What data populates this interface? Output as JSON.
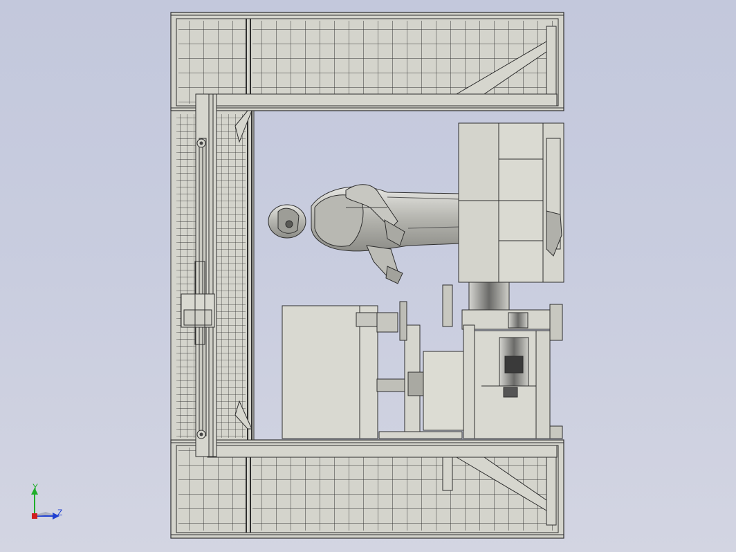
{
  "view": {
    "background_top": "#c3c8dc",
    "background_bottom": "#d3d5e2",
    "line_color": "#2e2e2e",
    "part_fill": "#d8d8cf",
    "panel_fill": "#dcdcd3",
    "figure_fill": "#c9c9c4"
  },
  "triad": {
    "y_label": "Y",
    "z_label": "Z",
    "y_color": "#1fae2a",
    "z_color": "#1f3fd1",
    "origin_color": "#d01f1f"
  }
}
